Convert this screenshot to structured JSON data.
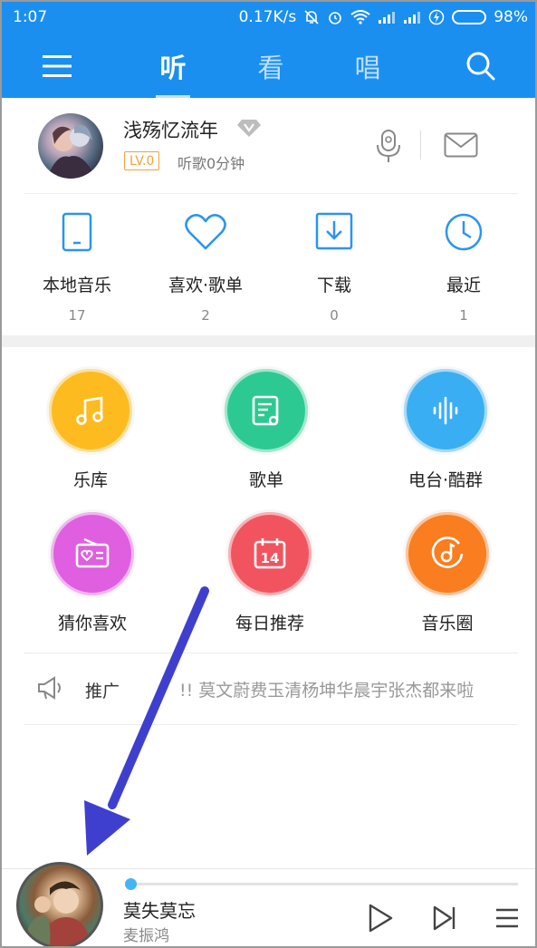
{
  "status": {
    "time": "1:07",
    "speed": "0.17K/s",
    "battery": "98%",
    "battery_level": 0.98
  },
  "nav": {
    "tabs": [
      "听",
      "看",
      "唱"
    ],
    "active_tab": "听"
  },
  "profile": {
    "username": "浅殇忆流年",
    "level": "LV.0",
    "listen_time": "听歌0分钟"
  },
  "quick": [
    {
      "label": "本地音乐",
      "count": "17",
      "icon": "phone-icon"
    },
    {
      "label": "喜欢·歌单",
      "count": "2",
      "icon": "heart-icon"
    },
    {
      "label": "下载",
      "count": "0",
      "icon": "download-icon"
    },
    {
      "label": "最近",
      "count": "1",
      "icon": "clock-icon"
    }
  ],
  "features": [
    {
      "label": "乐库",
      "color": "#fdbb1f",
      "icon": "music-note-icon"
    },
    {
      "label": "歌单",
      "color": "#2dc993",
      "icon": "playlist-icon"
    },
    {
      "label": "电台·酷群",
      "color": "#3aaef2",
      "icon": "sound-wave-icon"
    },
    {
      "label": "猜你喜欢",
      "color": "#e05ee0",
      "icon": "radio-heart-icon"
    },
    {
      "label": "每日推荐",
      "color": "#f2545f",
      "icon": "calendar-icon",
      "day": "14"
    },
    {
      "label": "音乐圈",
      "color": "#fa7d1f",
      "icon": "music-disc-icon"
    }
  ],
  "promo": {
    "label": "推广",
    "text": "!! 莫文蔚费玉清杨坤华晨宇张杰都来啦"
  },
  "player": {
    "title": "莫失莫忘",
    "artist": "麦振鸿",
    "progress": 0.0
  },
  "colors": {
    "brand_blue": "#1a8ff0",
    "arrow": "#3f3fcf"
  }
}
